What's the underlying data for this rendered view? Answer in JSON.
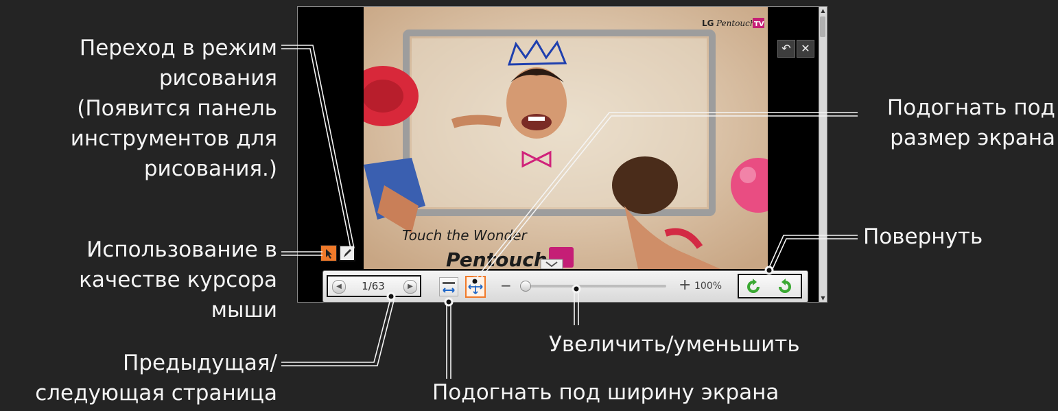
{
  "viewer": {
    "brand_lg": "LG",
    "brand_pentouch": "Pentouch",
    "brand_tv": "TV",
    "photo_text_1": "Touch the Wonder",
    "photo_text_2": "Pentouch",
    "page_indicator": "1/63",
    "zoom_minus": "−",
    "zoom_plus": "+",
    "zoom_value": "100%",
    "zoom_level_fraction": 0.02
  },
  "annotations": {
    "draw_mode": [
      "Переход в режим",
      "рисования",
      "(Появится панель",
      "инструментов для",
      "рисования.)"
    ],
    "cursor_mode": [
      "Использование в",
      "качестве курсора",
      "мыши"
    ],
    "prev_next": [
      "Предыдущая/",
      "следующая страница"
    ],
    "fit_screen": [
      "Подогнать под",
      "размер экрана"
    ],
    "rotate": "Повернуть",
    "zoom": "Увеличить/уменьшить",
    "fit_width": "Подогнать под ширину экрана"
  },
  "colors": {
    "background": "#242424",
    "accent_orange": "#f07a2a",
    "rotate_green": "#3aa832"
  },
  "icons": [
    "undo-icon",
    "close-icon",
    "cursor-icon",
    "pencil-icon",
    "prev-page-icon",
    "next-page-icon",
    "fit-width-icon",
    "fit-screen-icon",
    "rotate-left-icon",
    "rotate-right-icon"
  ]
}
